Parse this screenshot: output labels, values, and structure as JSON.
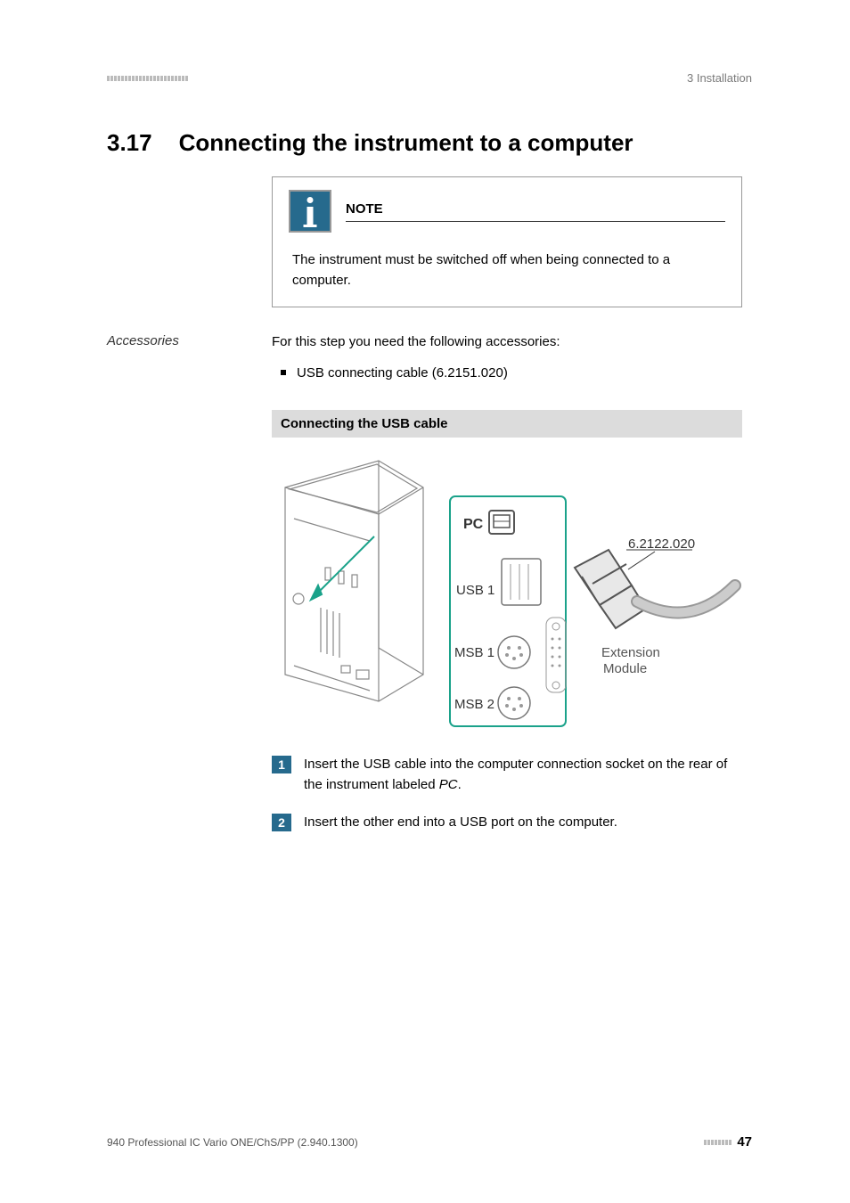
{
  "header": {
    "chapter_ref": "3 Installation"
  },
  "heading": {
    "number": "3.17",
    "title": "Connecting the instrument to a computer"
  },
  "note": {
    "label": "NOTE",
    "body": "The instrument must be switched off when being connected to a computer."
  },
  "side_label": "Accessories",
  "accessories_intro": "For this step you need the following accessories:",
  "accessories_list": {
    "item1": "USB connecting cable (6.2151.020)"
  },
  "subheading": "Connecting the USB cable",
  "figure_labels": {
    "pc": "PC",
    "usb1": "USB 1",
    "msb1": "MSB 1",
    "msb2": "MSB 2",
    "part": "6.2122.020",
    "ext1": "Extension",
    "ext2": "Module"
  },
  "steps": {
    "s1": {
      "num": "1",
      "text_a": "Insert the USB cable into the computer connection socket on the rear of the instrument labeled ",
      "text_em": "PC",
      "text_b": "."
    },
    "s2": {
      "num": "2",
      "text": "Insert the other end into a USB port on the computer."
    }
  },
  "footer": {
    "left": "940 Professional IC Vario ONE/ChS/PP (2.940.1300)",
    "page": "47"
  }
}
